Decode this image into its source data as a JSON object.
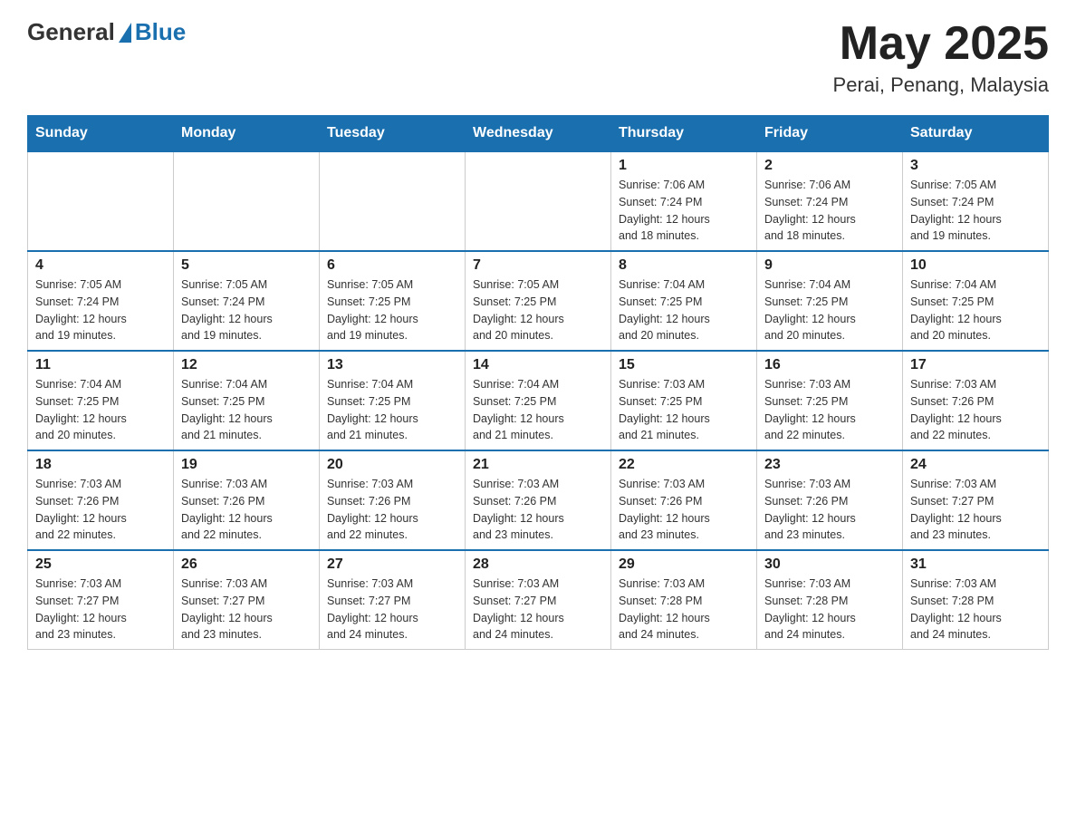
{
  "header": {
    "logo": {
      "general": "General",
      "blue": "Blue"
    },
    "month_year": "May 2025",
    "location": "Perai, Penang, Malaysia"
  },
  "days_of_week": [
    "Sunday",
    "Monday",
    "Tuesday",
    "Wednesday",
    "Thursday",
    "Friday",
    "Saturday"
  ],
  "weeks": [
    {
      "days": [
        {
          "date": "",
          "info": ""
        },
        {
          "date": "",
          "info": ""
        },
        {
          "date": "",
          "info": ""
        },
        {
          "date": "",
          "info": ""
        },
        {
          "date": "1",
          "info": "Sunrise: 7:06 AM\nSunset: 7:24 PM\nDaylight: 12 hours\nand 18 minutes."
        },
        {
          "date": "2",
          "info": "Sunrise: 7:06 AM\nSunset: 7:24 PM\nDaylight: 12 hours\nand 18 minutes."
        },
        {
          "date": "3",
          "info": "Sunrise: 7:05 AM\nSunset: 7:24 PM\nDaylight: 12 hours\nand 19 minutes."
        }
      ]
    },
    {
      "days": [
        {
          "date": "4",
          "info": "Sunrise: 7:05 AM\nSunset: 7:24 PM\nDaylight: 12 hours\nand 19 minutes."
        },
        {
          "date": "5",
          "info": "Sunrise: 7:05 AM\nSunset: 7:24 PM\nDaylight: 12 hours\nand 19 minutes."
        },
        {
          "date": "6",
          "info": "Sunrise: 7:05 AM\nSunset: 7:25 PM\nDaylight: 12 hours\nand 19 minutes."
        },
        {
          "date": "7",
          "info": "Sunrise: 7:05 AM\nSunset: 7:25 PM\nDaylight: 12 hours\nand 20 minutes."
        },
        {
          "date": "8",
          "info": "Sunrise: 7:04 AM\nSunset: 7:25 PM\nDaylight: 12 hours\nand 20 minutes."
        },
        {
          "date": "9",
          "info": "Sunrise: 7:04 AM\nSunset: 7:25 PM\nDaylight: 12 hours\nand 20 minutes."
        },
        {
          "date": "10",
          "info": "Sunrise: 7:04 AM\nSunset: 7:25 PM\nDaylight: 12 hours\nand 20 minutes."
        }
      ]
    },
    {
      "days": [
        {
          "date": "11",
          "info": "Sunrise: 7:04 AM\nSunset: 7:25 PM\nDaylight: 12 hours\nand 20 minutes."
        },
        {
          "date": "12",
          "info": "Sunrise: 7:04 AM\nSunset: 7:25 PM\nDaylight: 12 hours\nand 21 minutes."
        },
        {
          "date": "13",
          "info": "Sunrise: 7:04 AM\nSunset: 7:25 PM\nDaylight: 12 hours\nand 21 minutes."
        },
        {
          "date": "14",
          "info": "Sunrise: 7:04 AM\nSunset: 7:25 PM\nDaylight: 12 hours\nand 21 minutes."
        },
        {
          "date": "15",
          "info": "Sunrise: 7:03 AM\nSunset: 7:25 PM\nDaylight: 12 hours\nand 21 minutes."
        },
        {
          "date": "16",
          "info": "Sunrise: 7:03 AM\nSunset: 7:25 PM\nDaylight: 12 hours\nand 22 minutes."
        },
        {
          "date": "17",
          "info": "Sunrise: 7:03 AM\nSunset: 7:26 PM\nDaylight: 12 hours\nand 22 minutes."
        }
      ]
    },
    {
      "days": [
        {
          "date": "18",
          "info": "Sunrise: 7:03 AM\nSunset: 7:26 PM\nDaylight: 12 hours\nand 22 minutes."
        },
        {
          "date": "19",
          "info": "Sunrise: 7:03 AM\nSunset: 7:26 PM\nDaylight: 12 hours\nand 22 minutes."
        },
        {
          "date": "20",
          "info": "Sunrise: 7:03 AM\nSunset: 7:26 PM\nDaylight: 12 hours\nand 22 minutes."
        },
        {
          "date": "21",
          "info": "Sunrise: 7:03 AM\nSunset: 7:26 PM\nDaylight: 12 hours\nand 23 minutes."
        },
        {
          "date": "22",
          "info": "Sunrise: 7:03 AM\nSunset: 7:26 PM\nDaylight: 12 hours\nand 23 minutes."
        },
        {
          "date": "23",
          "info": "Sunrise: 7:03 AM\nSunset: 7:26 PM\nDaylight: 12 hours\nand 23 minutes."
        },
        {
          "date": "24",
          "info": "Sunrise: 7:03 AM\nSunset: 7:27 PM\nDaylight: 12 hours\nand 23 minutes."
        }
      ]
    },
    {
      "days": [
        {
          "date": "25",
          "info": "Sunrise: 7:03 AM\nSunset: 7:27 PM\nDaylight: 12 hours\nand 23 minutes."
        },
        {
          "date": "26",
          "info": "Sunrise: 7:03 AM\nSunset: 7:27 PM\nDaylight: 12 hours\nand 23 minutes."
        },
        {
          "date": "27",
          "info": "Sunrise: 7:03 AM\nSunset: 7:27 PM\nDaylight: 12 hours\nand 24 minutes."
        },
        {
          "date": "28",
          "info": "Sunrise: 7:03 AM\nSunset: 7:27 PM\nDaylight: 12 hours\nand 24 minutes."
        },
        {
          "date": "29",
          "info": "Sunrise: 7:03 AM\nSunset: 7:28 PM\nDaylight: 12 hours\nand 24 minutes."
        },
        {
          "date": "30",
          "info": "Sunrise: 7:03 AM\nSunset: 7:28 PM\nDaylight: 12 hours\nand 24 minutes."
        },
        {
          "date": "31",
          "info": "Sunrise: 7:03 AM\nSunset: 7:28 PM\nDaylight: 12 hours\nand 24 minutes."
        }
      ]
    }
  ]
}
